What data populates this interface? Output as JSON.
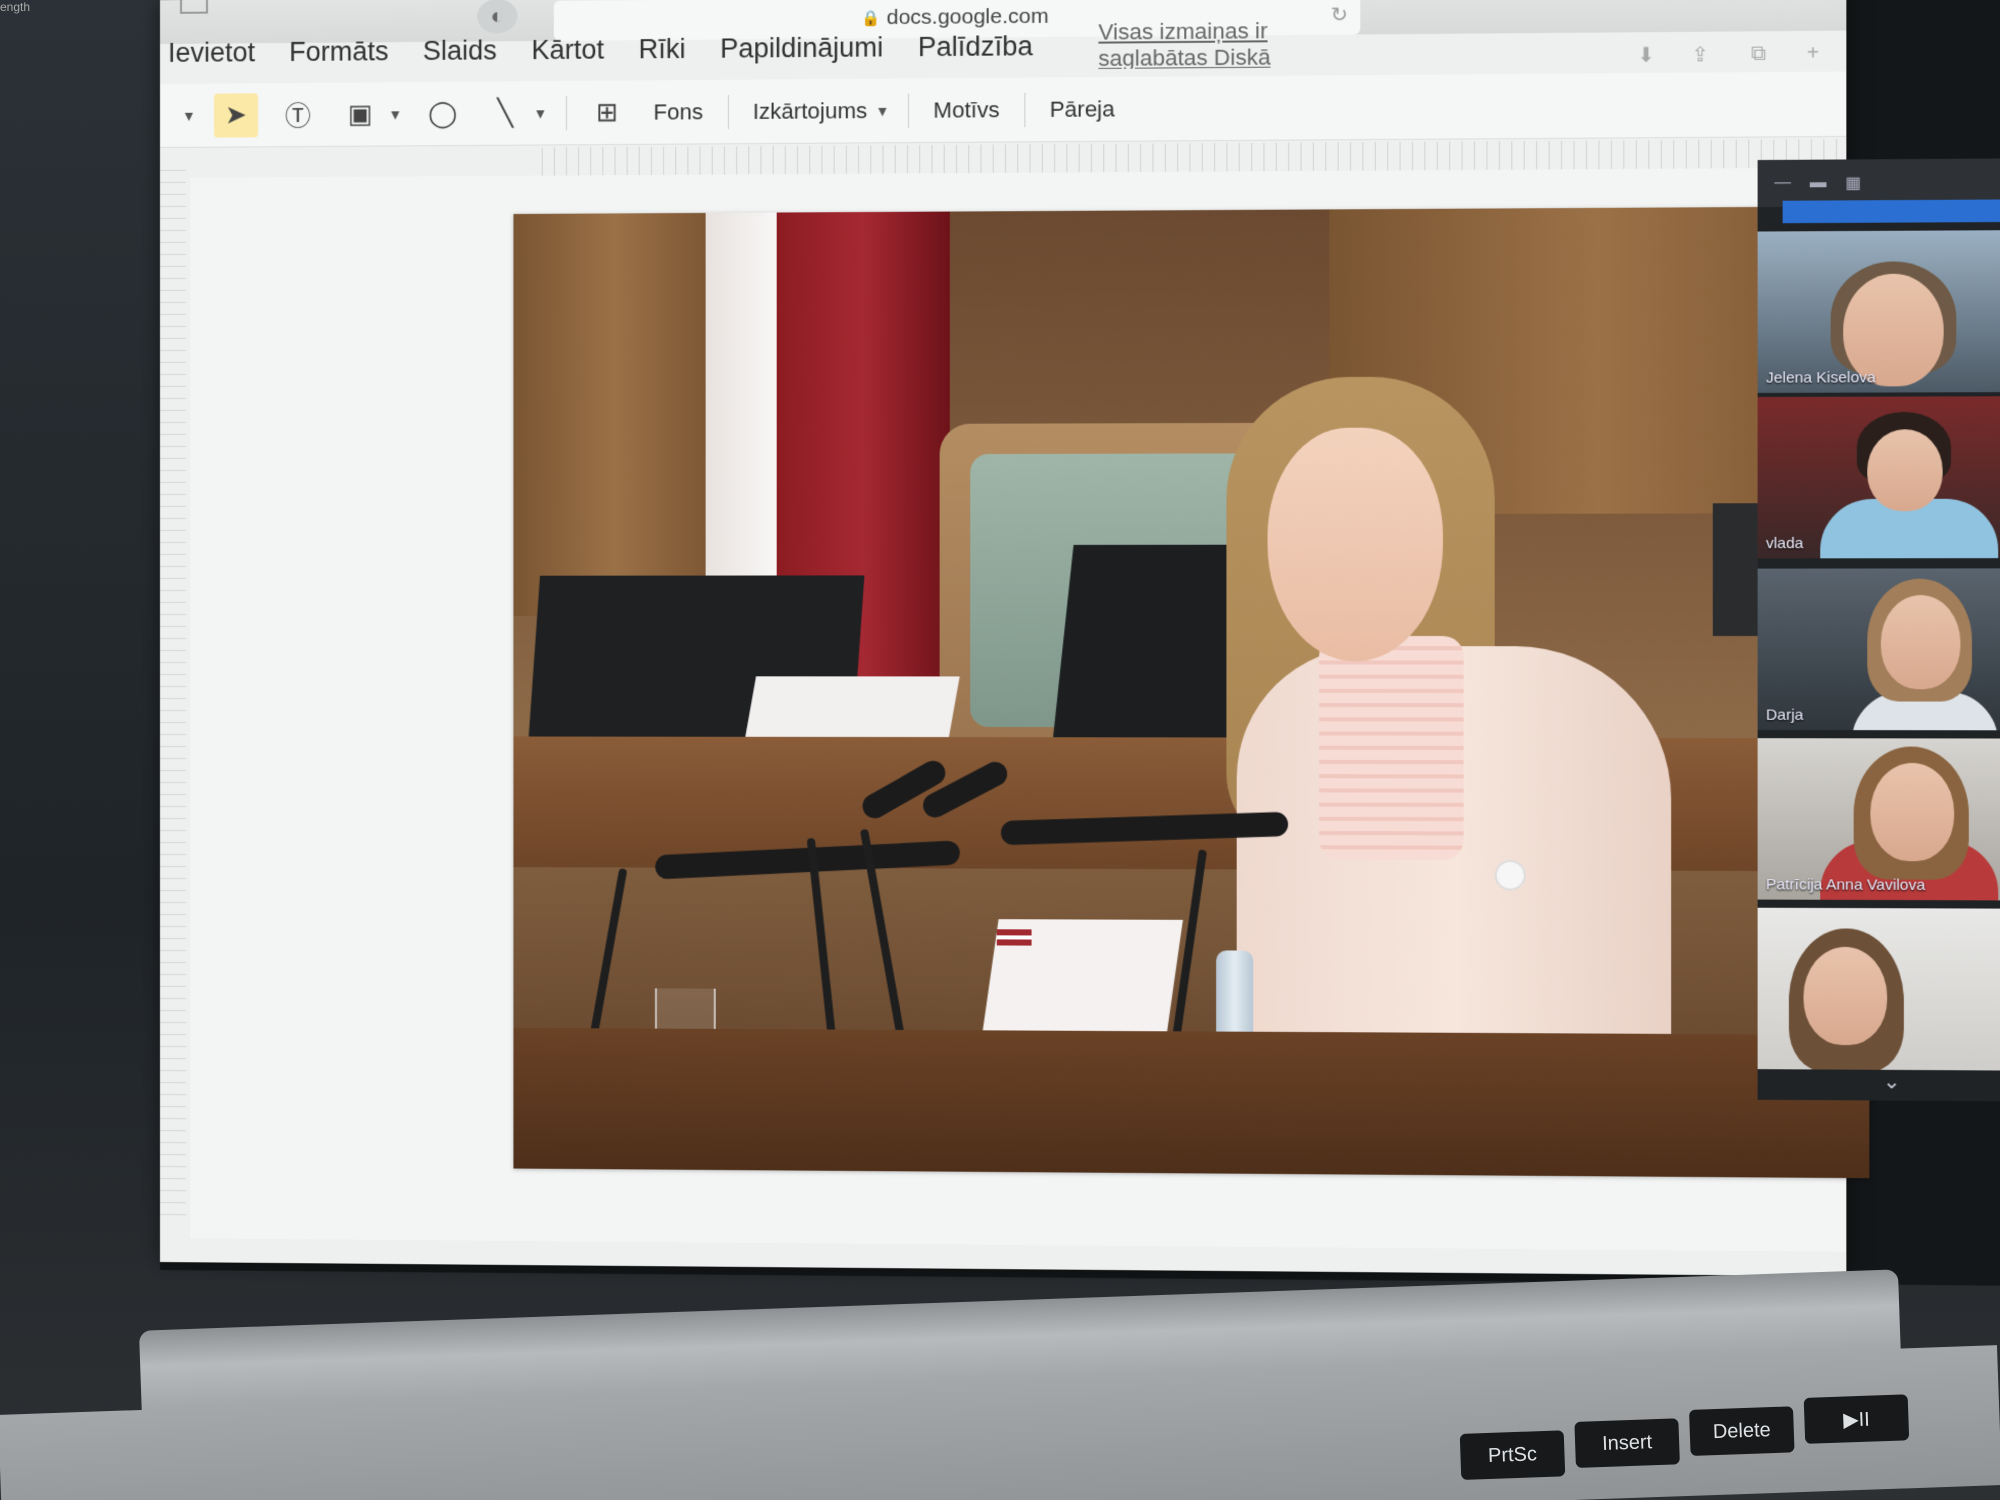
{
  "corner_text": "ength",
  "browser": {
    "url": "docs.google.com",
    "lock_icon": "lock-icon",
    "reload_icon": "reload-icon"
  },
  "menubar": {
    "items": [
      "Ievietot",
      "Formāts",
      "Slaids",
      "Kārtot",
      "Rīki",
      "Papildinājumi",
      "Palīdzība"
    ],
    "saved_status": "Visas izmaiņas ir saglabātas Diskā"
  },
  "toolbar": {
    "fons": "Fons",
    "izkartojums": "Izkārtojums",
    "motivs": "Motīvs",
    "pareja": "Pāreja"
  },
  "participants": [
    {
      "name": "Jelena Kiselova"
    },
    {
      "name": "vlada"
    },
    {
      "name": "Darja"
    },
    {
      "name": "Patrīcija Anna Vavilova"
    },
    {
      "name": ""
    }
  ],
  "keyboard": {
    "keys": [
      "PrtSc",
      "Insert",
      "Delete",
      "▶II"
    ]
  },
  "colors": {
    "selected_tool": "#fbe9a8",
    "call_banner": "#2a6fd1",
    "flag_red": "#a52832"
  }
}
